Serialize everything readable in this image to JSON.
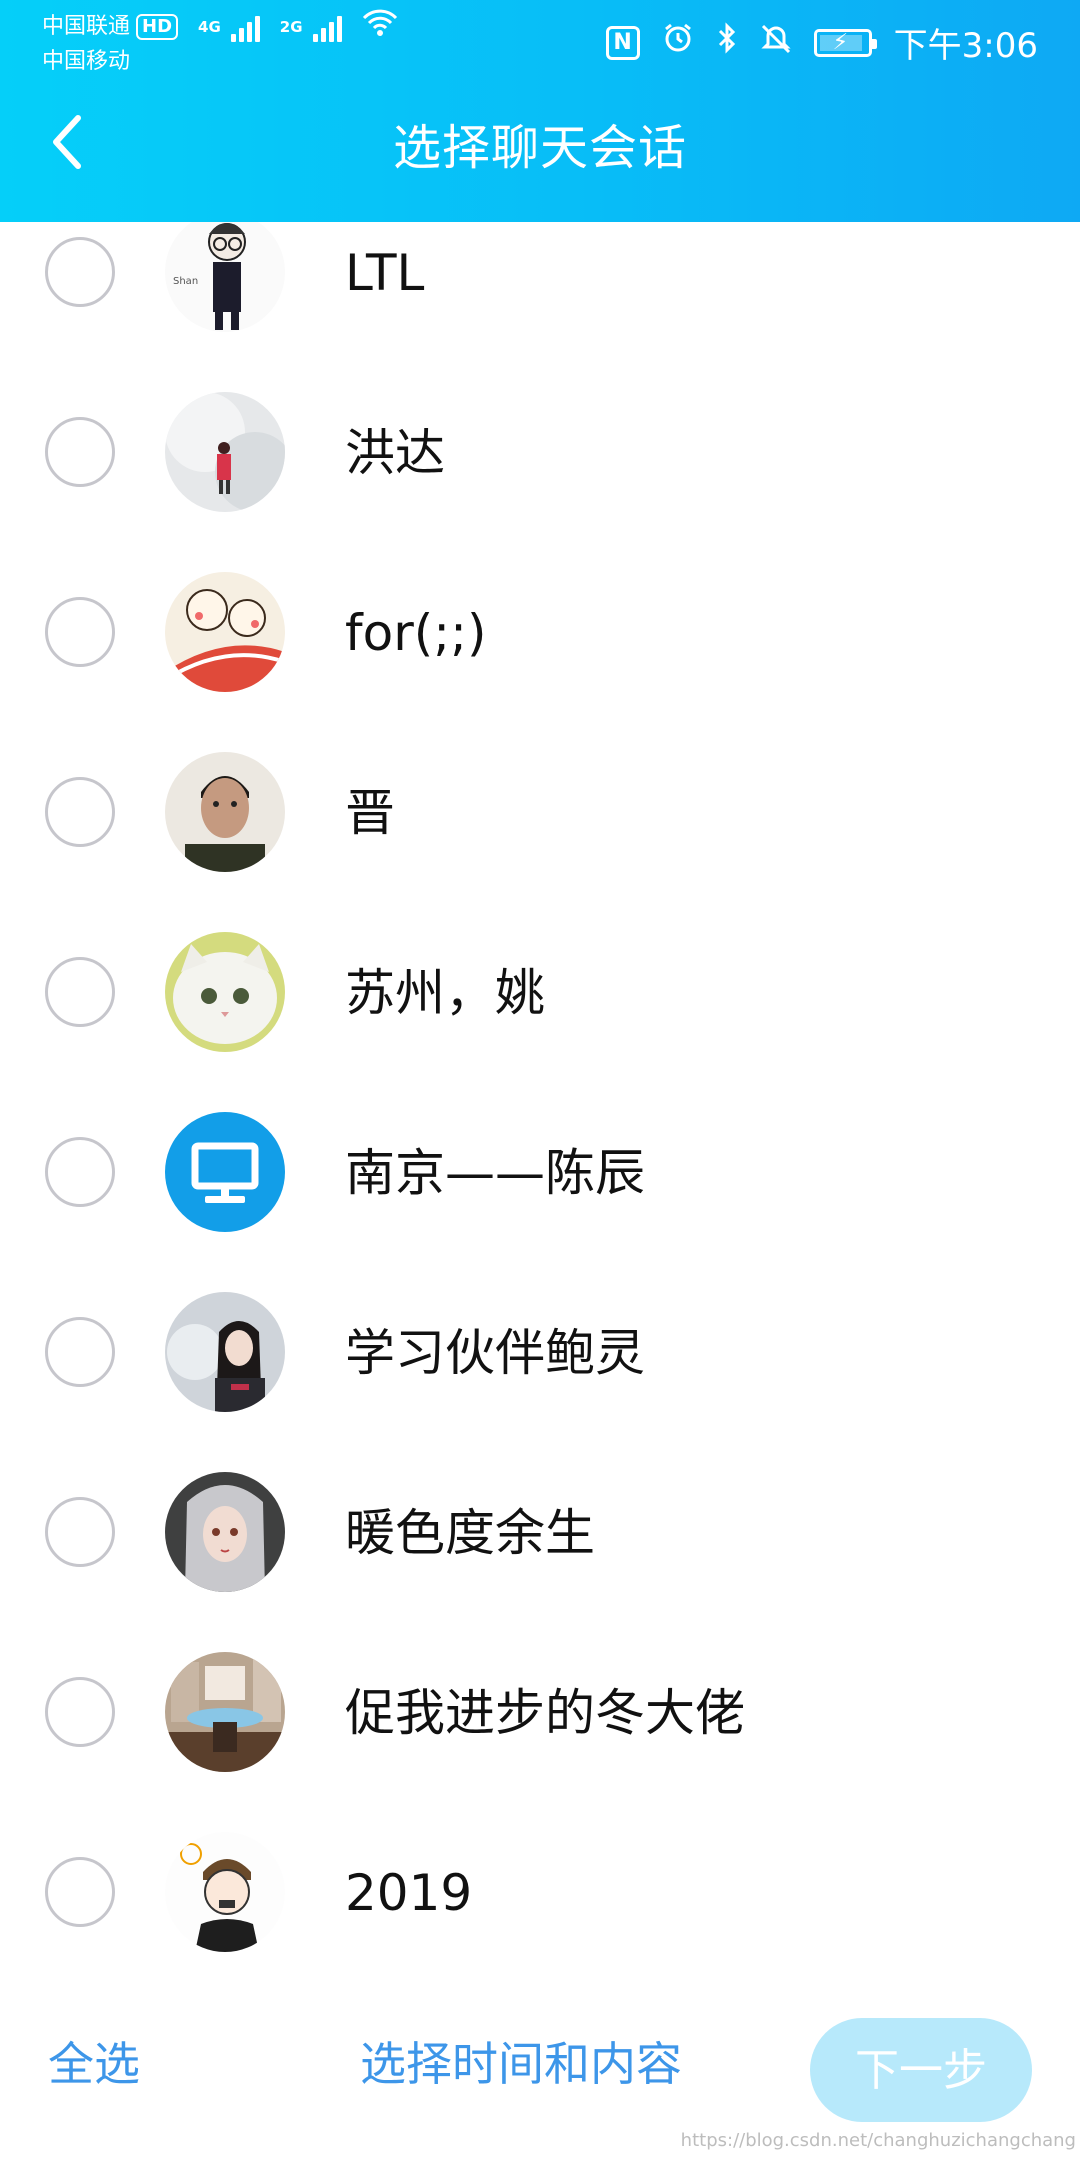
{
  "status_bar": {
    "carrier1": "中国联通",
    "hd_badge": "HD",
    "net1": "4G",
    "carrier2": "中国移动",
    "net2": "2G",
    "time": "下午3:06"
  },
  "header": {
    "title": "选择聊天会话"
  },
  "contacts": [
    {
      "name": "LTL"
    },
    {
      "name": "洪达"
    },
    {
      "name": "for(;;)"
    },
    {
      "name": "晋"
    },
    {
      "name": "苏州，姚"
    },
    {
      "name": "南京——陈辰"
    },
    {
      "name": "学习伙伴鲍灵"
    },
    {
      "name": "暖色度余生"
    },
    {
      "name": "促我进步的冬大佬"
    },
    {
      "name": "2019"
    }
  ],
  "bottom_bar": {
    "select_all": "全选",
    "select_time": "选择时间和内容",
    "next": "下一步"
  },
  "watermark": "https://blog.csdn.net/changhuzichangchang",
  "colors": {
    "header_start": "#05cff9",
    "header_end": "#0ea9f4",
    "accent_text": "#3d96e9",
    "next_button": "#b7e9fb",
    "radio_border": "#c6c6cc"
  }
}
